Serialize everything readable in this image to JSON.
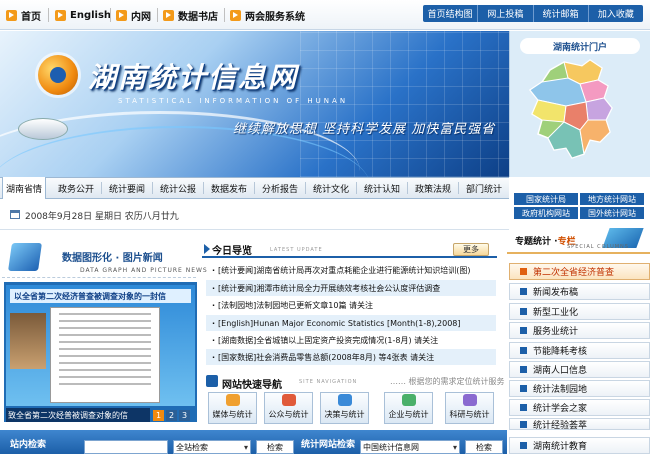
{
  "top_nav": [
    {
      "label": "首页"
    },
    {
      "label": "English"
    },
    {
      "label": "内网"
    },
    {
      "label": "数据书店"
    },
    {
      "label": "两会服务系统"
    }
  ],
  "top_right_links": [
    "首页结构图",
    "网上投稿",
    "统计邮箱",
    "加入收藏"
  ],
  "banner": {
    "title": "湖南统计信息网",
    "subtitle": "STATISTICAL INFORMATION OF HUNAN",
    "slogan": "继续解放思想 坚持科学发展 加快富民强省"
  },
  "portal": {
    "title": "湖南统计门户",
    "links": [
      "国家统计局",
      "地方统计网站",
      "政府机构网站",
      "国外统计网站"
    ]
  },
  "main_nav": [
    "湖南省情",
    "政务公开",
    "统计要闻",
    "统计公报",
    "数据发布",
    "分析报告",
    "统计文化",
    "统计认知",
    "政策法规",
    "部门统计"
  ],
  "date": "2008年9月28日 星期日 农历八月廿九",
  "picture_news": {
    "title": "数据图形化 · 图片新闻",
    "subtitle": "DATA GRAPH AND PICTURE NEWS",
    "image_header": "以全省第二次经济普查被调查对象的一封信",
    "caption": "致全省第二次经普被调查对象的信",
    "pages": [
      "1",
      "2",
      "3"
    ]
  },
  "today": {
    "title": "今日导览",
    "subtitle": "LATEST UPDATE",
    "more": "更多",
    "items": [
      "[统计要闻]湖南省统计局再次对重点耗能企业进行能源统计知识培训(图)",
      "[统计要闻]湘潭市统计局全力开展绩效考核社会公认度评估调查",
      "[法制园地]法制园地已更新文章10篇 请关注",
      "[English]Hunan Major Economic Statistics [Month(1-8),2008]",
      "[湖南数据]全省城镇以上固定资产投资完成情况(1-8月) 请关注",
      "[国家数据]社会消费品零售总额(2008年8月) 等4张表 请关注"
    ]
  },
  "quick_nav": {
    "title": "网站快速导航",
    "subtitle": "SITE NAVIGATION",
    "hint": "…… 根据您的需求定位统计服务",
    "items": [
      "媒体与统计",
      "公众与统计",
      "决策与统计",
      "企业与统计",
      "科研与统计"
    ]
  },
  "special": {
    "title_a": "专题统计 ·",
    "title_b": "专栏",
    "subtitle": "SPECIAL COLUMNS",
    "items": [
      "第二次全省经济普查",
      "新闻发布稿",
      "新型工业化",
      "服务业统计",
      "节能降耗考核",
      "湖南人口信息",
      "统计法制园地",
      "统计学会之家",
      "统计经验荟萃",
      "湖南统计教育"
    ]
  },
  "search": {
    "label": "站内检索",
    "scope": "全站检索",
    "button": "检索",
    "link_label": "统计网站检索",
    "link_scope": "中国统计信息网",
    "link_button": "检索"
  },
  "colors": {
    "brand": "#1c5fa8",
    "accent": "#f39a1a",
    "highlight": "#c03000"
  }
}
